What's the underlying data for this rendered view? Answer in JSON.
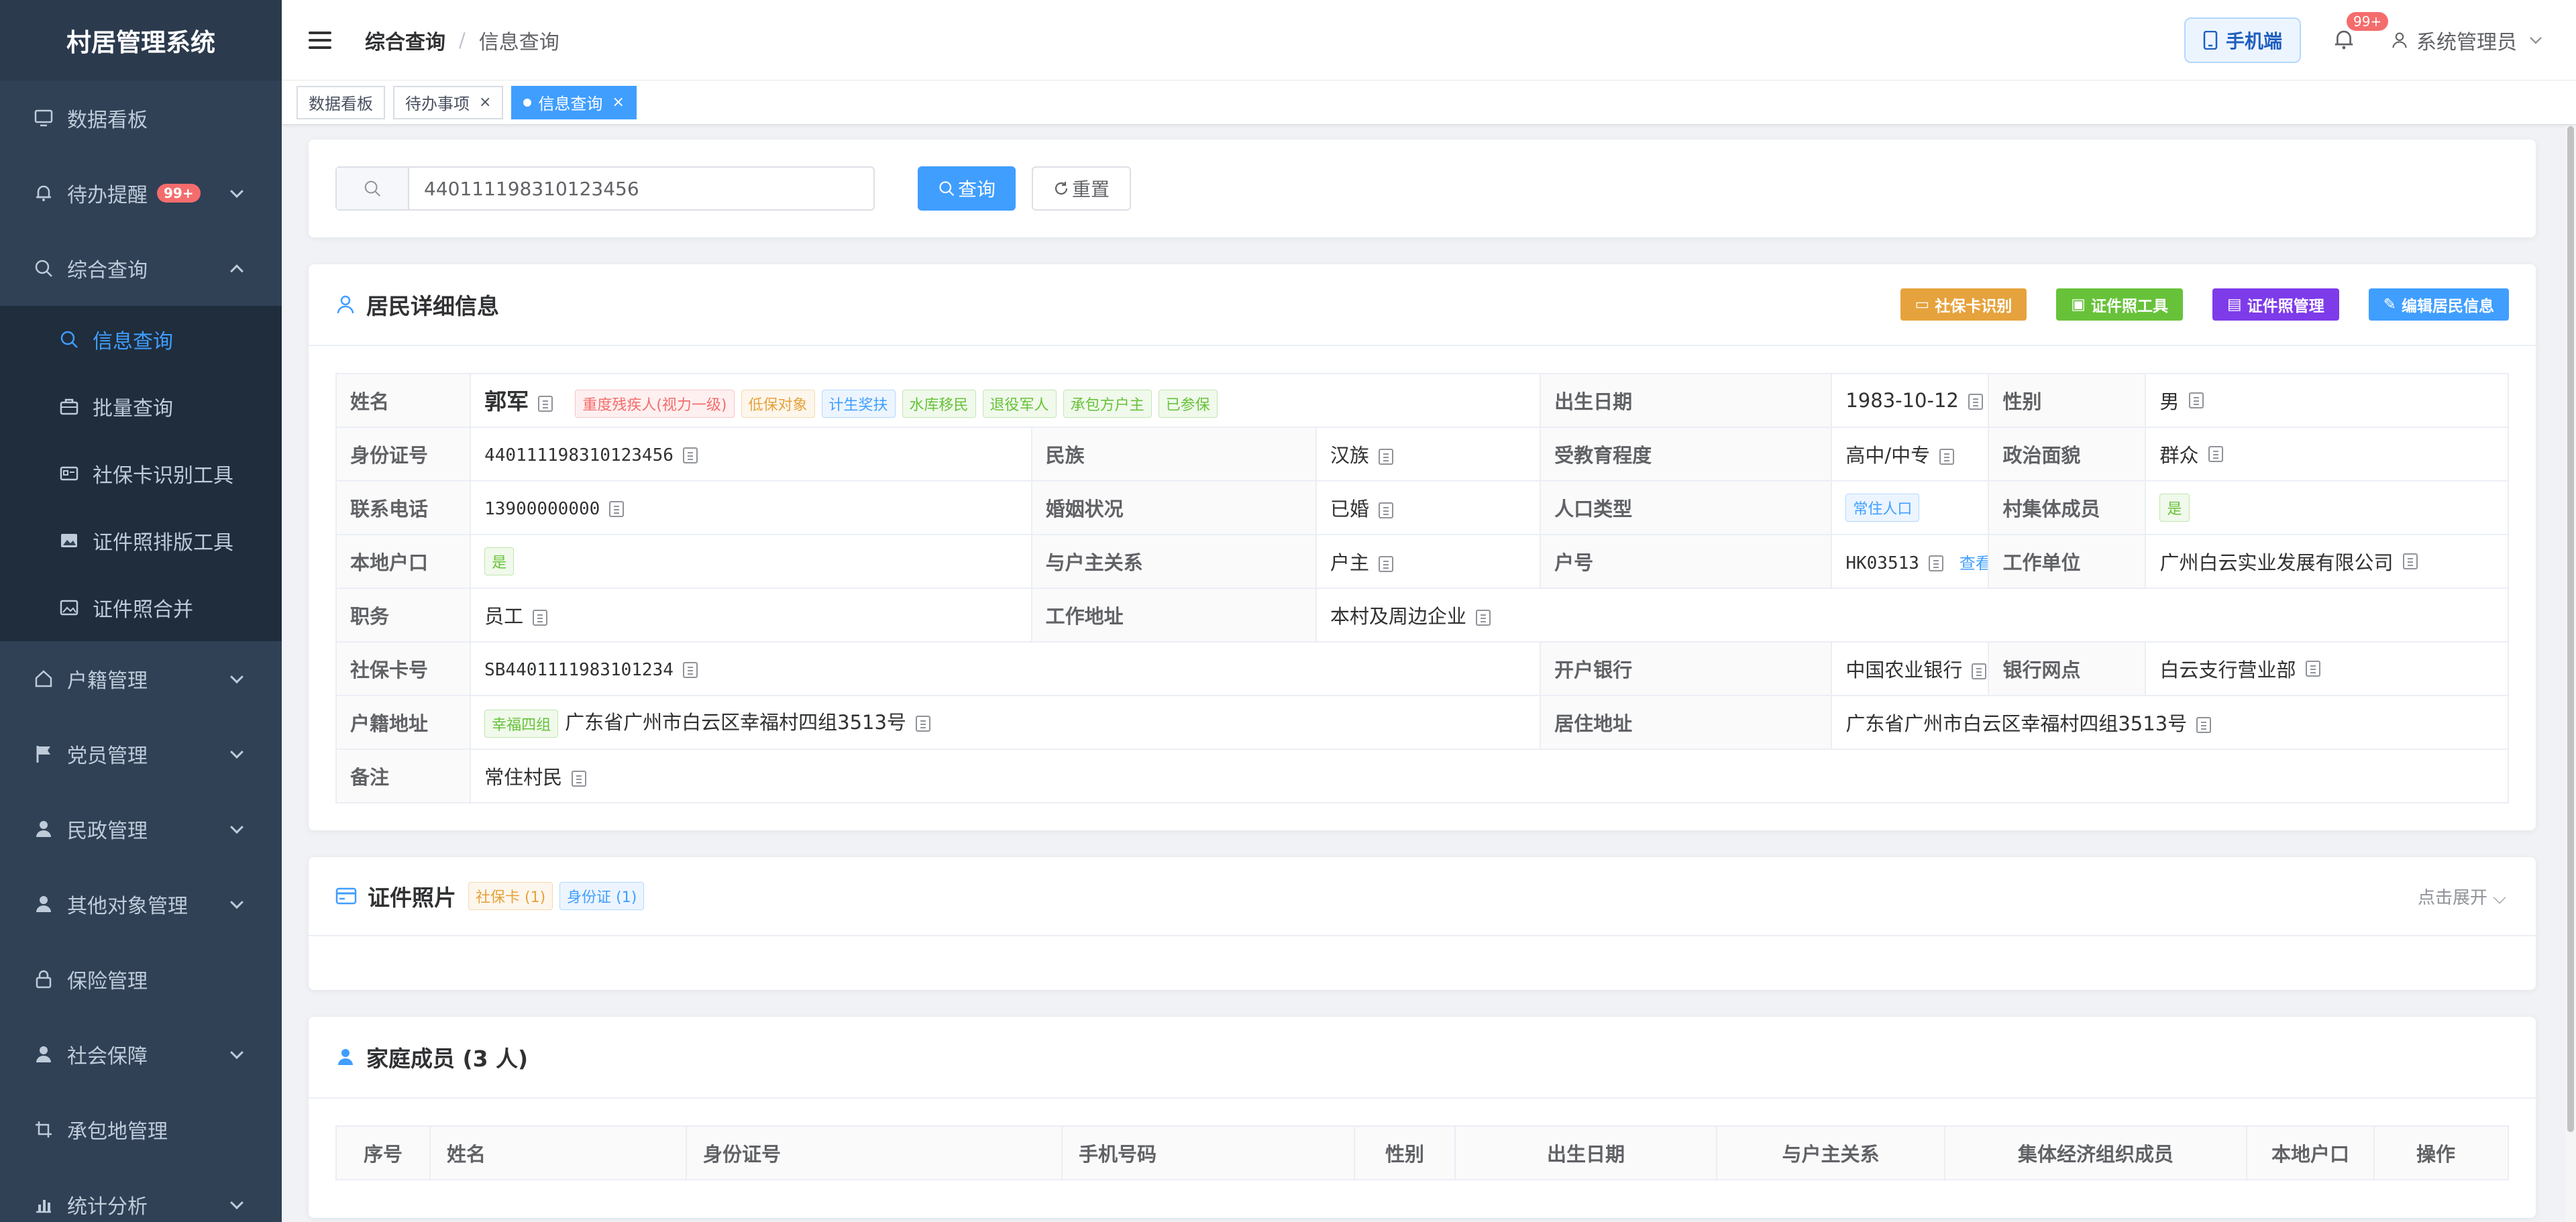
{
  "app": {
    "title": "村居管理系统"
  },
  "sidebar": {
    "items": [
      {
        "label": "数据看板",
        "icon": "monitor-icon"
      },
      {
        "label": "待办提醒",
        "icon": "bell-icon",
        "badge": "99+"
      },
      {
        "label": "综合查询",
        "icon": "search-icon"
      },
      {
        "label": "信息查询",
        "icon": "search-icon"
      },
      {
        "label": "批量查询",
        "icon": "briefcase-icon"
      },
      {
        "label": "社保卡识别工具",
        "icon": "card-icon"
      },
      {
        "label": "证件照排版工具",
        "icon": "image-icon"
      },
      {
        "label": "证件照合并",
        "icon": "picture-icon"
      },
      {
        "label": "户籍管理",
        "icon": "home-icon"
      },
      {
        "label": "党员管理",
        "icon": "flag-icon"
      },
      {
        "label": "民政管理",
        "icon": "user-icon"
      },
      {
        "label": "其他对象管理",
        "icon": "user-icon"
      },
      {
        "label": "保险管理",
        "icon": "lock-icon"
      },
      {
        "label": "社会保障",
        "icon": "user-icon"
      },
      {
        "label": "承包地管理",
        "icon": "crop-icon"
      },
      {
        "label": "统计分析",
        "icon": "chart-icon"
      }
    ]
  },
  "navbar": {
    "breadcrumb_parent": "综合查询",
    "breadcrumb_current": "信息查询",
    "mobile_label": "手机端",
    "notify_count": "99+",
    "user_name": "系统管理员"
  },
  "tabs": [
    {
      "label": "数据看板"
    },
    {
      "label": "待办事项"
    },
    {
      "label": "信息查询"
    }
  ],
  "search": {
    "value": "440111198310123456",
    "query_label": "查询",
    "reset_label": "重置"
  },
  "resident": {
    "title": "居民详细信息",
    "actions": [
      {
        "label": "社保卡识别",
        "color": "#e6a23c"
      },
      {
        "label": "证件照工具",
        "color": "#67c23a"
      },
      {
        "label": "证件照管理",
        "color": "#7e3bea"
      },
      {
        "label": "编辑居民信息",
        "color": "#409eff"
      }
    ],
    "labels": {
      "name": "姓名",
      "birth": "出生日期",
      "gender": "性别",
      "idno": "身份证号",
      "ethnic": "民族",
      "edu": "受教育程度",
      "political": "政治面貌",
      "phone": "联系电话",
      "marital": "婚姻状况",
      "poptype": "人口类型",
      "collective": "村集体成员",
      "local": "本地户口",
      "relation": "与户主关系",
      "household": "户号",
      "employer": "工作单位",
      "job": "职务",
      "workaddr": "工作地址",
      "sscard": "社保卡号",
      "bank": "开户银行",
      "branch": "银行网点",
      "regaddr": "户籍地址",
      "resaddr": "居住地址",
      "remark": "备注"
    },
    "values": {
      "name": "郭军",
      "tags": [
        "重度残疾人(视力一级)",
        "低保对象",
        "计生奖扶",
        "水库移民",
        "退役军人",
        "承包方户主",
        "已参保"
      ],
      "birth": "1983-10-12",
      "gender": "男",
      "idno": "440111198310123456",
      "ethnic": "汉族",
      "edu": "高中/中专",
      "political": "群众",
      "phone": "13900000000",
      "marital": "已婚",
      "poptype": "常住人口",
      "collective": "是",
      "local": "是",
      "relation": "户主",
      "household": "HK03513",
      "household_link": "查看户详情",
      "employer": "广州白云实业发展有限公司",
      "job": "员工",
      "workaddr": "本村及周边企业",
      "sscard": "SB4401111983101234",
      "bank": "中国农业银行",
      "branch": "白云支行营业部",
      "reg_group": "幸福四组",
      "regaddr": "广东省广州市白云区幸福村四组3513号",
      "resaddr": "广东省广州市白云区幸福村四组3513号",
      "remark": "常住村民"
    }
  },
  "certificates": {
    "title": "证件照片",
    "tags": [
      "社保卡 (1)",
      "身份证 (1)"
    ],
    "expand_label": "点击展开"
  },
  "family": {
    "title": "家庭成员 (3 人)",
    "columns": [
      "序号",
      "姓名",
      "身份证号",
      "手机号码",
      "性别",
      "出生日期",
      "与户主关系",
      "集体经济组织成员",
      "本地户口",
      "操作"
    ]
  }
}
